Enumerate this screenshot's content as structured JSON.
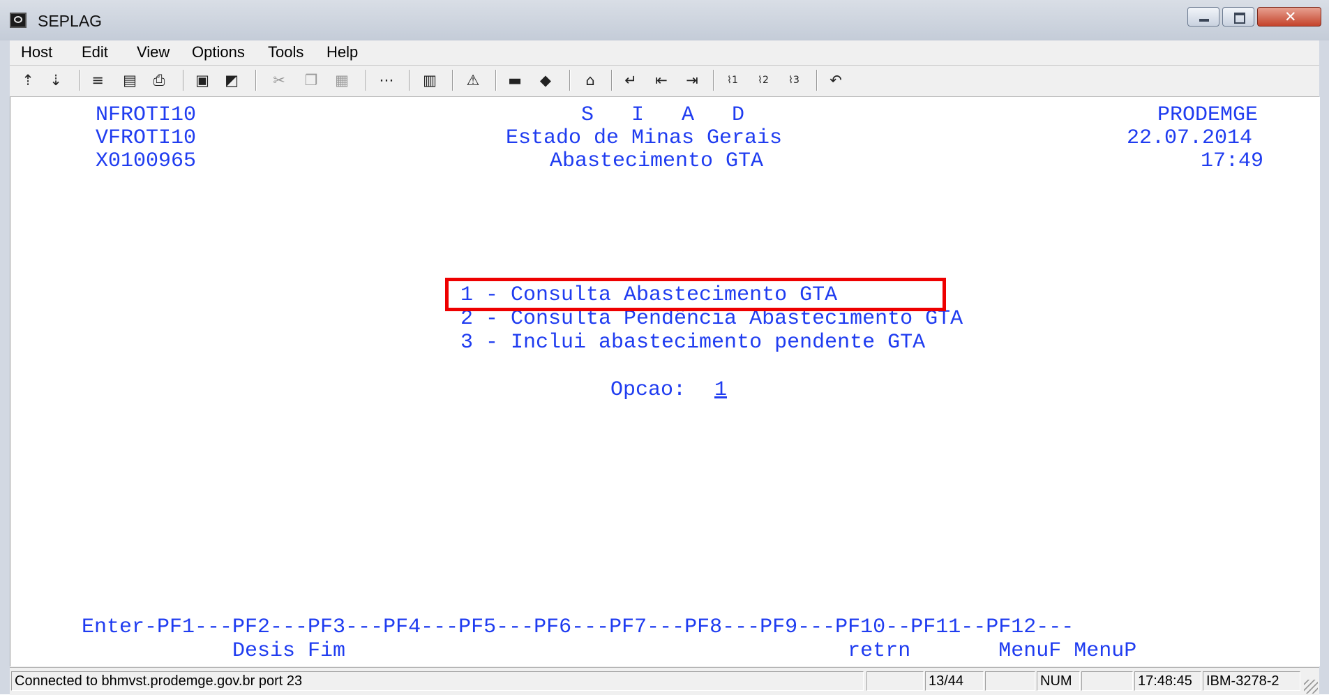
{
  "window": {
    "title": "SEPLAG"
  },
  "menu": [
    "Host",
    "Edit",
    "View",
    "Options",
    "Tools",
    "Help"
  ],
  "toolbar_icons": [
    "send-file-icon",
    "receive-file-icon",
    "run-macro-icon",
    "print-screen-icon",
    "printer-icon",
    "save-session-icon",
    "open-session-icon",
    "cut-icon",
    "copy-icon",
    "paste-icon",
    "keypad-icon",
    "chart-icon",
    "warning-icon",
    "display-icon",
    "eraser-icon",
    "home-icon",
    "enter-icon",
    "tab-back-icon",
    "tab-forward-icon",
    "pa1-icon",
    "pa2-icon",
    "pa3-icon",
    "undo-icon"
  ],
  "screen": {
    "left": [
      "NFROTI10",
      "VFROTI10",
      "X0100965"
    ],
    "center": [
      "S   I   A   D",
      "Estado de Minas Gerais",
      "Abastecimento GTA"
    ],
    "right": [
      "PRODEMGE",
      "22.07.2014",
      "17:49"
    ],
    "options": [
      "1 - Consulta Abastecimento GTA",
      "2 - Consulta Pendência Abastecimento GTA",
      "3 - Inclui abastecimento pendente GTA"
    ],
    "opcao_label": "Opcao:",
    "opcao_value": "1",
    "pf_keys_line": "Enter-PF1---PF2---PF3---PF4---PF5---PF6---PF7---PF8---PF9---PF10--PF11--PF12---",
    "pf_labels_line": "            Desis Fim                                        retrn       MenuF MenuP"
  },
  "status": {
    "connection": "Connected to bhmvst.prodemge.gov.br port 23",
    "cursor": "13/44",
    "num": "NUM",
    "time": "17:48:45",
    "terminal_type": "IBM-3278-2"
  }
}
